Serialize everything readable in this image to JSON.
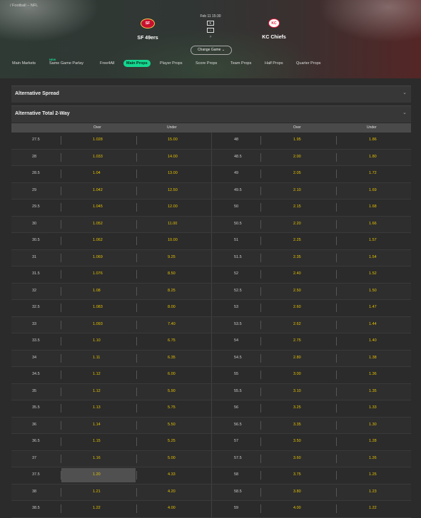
{
  "breadcrumb": "/ Football – NFL",
  "match": {
    "home_team": "SF 49ers",
    "away_team": "KC Chiefs",
    "datetime": "Feb 11 15:30",
    "change_game_label": "Change Game"
  },
  "tabs": [
    {
      "label": "Main Markets"
    },
    {
      "label": "Same Game Parlay",
      "badge": "NEW"
    },
    {
      "label": "Free4All"
    },
    {
      "label": "Main Props",
      "active": true
    },
    {
      "label": "Player Props"
    },
    {
      "label": "Score Props"
    },
    {
      "label": "Team Props"
    },
    {
      "label": "Half Props"
    },
    {
      "label": "Quarter Props"
    }
  ],
  "sections": {
    "spread_title": "Alternative Spread",
    "total_title": "Alternative Total 2-Way"
  },
  "table": {
    "headers": {
      "over": "Over",
      "under": "Under"
    },
    "rows": [
      {
        "l_pt": "27.5",
        "l_over": "1.028",
        "l_under": "15.00",
        "r_pt": "48",
        "r_over": "1.95",
        "r_under": "1.86"
      },
      {
        "l_pt": "28",
        "l_over": "1.033",
        "l_under": "14.00",
        "r_pt": "48.5",
        "r_over": "2.00",
        "r_under": "1.80"
      },
      {
        "l_pt": "28.5",
        "l_over": "1.04",
        "l_under": "13.00",
        "r_pt": "49",
        "r_over": "2.05",
        "r_under": "1.72"
      },
      {
        "l_pt": "29",
        "l_over": "1.042",
        "l_under": "12.50",
        "r_pt": "49.5",
        "r_over": "2.10",
        "r_under": "1.69"
      },
      {
        "l_pt": "29.5",
        "l_over": "1.045",
        "l_under": "12.00",
        "r_pt": "50",
        "r_over": "2.15",
        "r_under": "1.68"
      },
      {
        "l_pt": "30",
        "l_over": "1.052",
        "l_under": "11.00",
        "r_pt": "50.5",
        "r_over": "2.20",
        "r_under": "1.66"
      },
      {
        "l_pt": "30.5",
        "l_over": "1.062",
        "l_under": "10.00",
        "r_pt": "51",
        "r_over": "2.25",
        "r_under": "1.57"
      },
      {
        "l_pt": "31",
        "l_over": "1.069",
        "l_under": "9.25",
        "r_pt": "51.5",
        "r_over": "2.35",
        "r_under": "1.54"
      },
      {
        "l_pt": "31.5",
        "l_over": "1.076",
        "l_under": "8.50",
        "r_pt": "52",
        "r_over": "2.40",
        "r_under": "1.52"
      },
      {
        "l_pt": "32",
        "l_over": "1.08",
        "l_under": "8.25",
        "r_pt": "52.5",
        "r_over": "2.50",
        "r_under": "1.50"
      },
      {
        "l_pt": "32.5",
        "l_over": "1.083",
        "l_under": "8.00",
        "r_pt": "53",
        "r_over": "2.60",
        "r_under": "1.47"
      },
      {
        "l_pt": "33",
        "l_over": "1.093",
        "l_under": "7.40",
        "r_pt": "53.5",
        "r_over": "2.62",
        "r_under": "1.44"
      },
      {
        "l_pt": "33.5",
        "l_over": "1.10",
        "l_under": "6.75",
        "r_pt": "54",
        "r_over": "2.75",
        "r_under": "1.40"
      },
      {
        "l_pt": "34",
        "l_over": "1.11",
        "l_under": "6.35",
        "r_pt": "54.5",
        "r_over": "2.80",
        "r_under": "1.38"
      },
      {
        "l_pt": "34.5",
        "l_over": "1.12",
        "l_under": "6.00",
        "r_pt": "55",
        "r_over": "3.00",
        "r_under": "1.36"
      },
      {
        "l_pt": "35",
        "l_over": "1.12",
        "l_under": "5.90",
        "r_pt": "55.5",
        "r_over": "3.10",
        "r_under": "1.35"
      },
      {
        "l_pt": "35.5",
        "l_over": "1.13",
        "l_under": "5.75",
        "r_pt": "56",
        "r_over": "3.25",
        "r_under": "1.33"
      },
      {
        "l_pt": "36",
        "l_over": "1.14",
        "l_under": "5.50",
        "r_pt": "56.5",
        "r_over": "3.35",
        "r_under": "1.30"
      },
      {
        "l_pt": "36.5",
        "l_over": "1.15",
        "l_under": "5.25",
        "r_pt": "57",
        "r_over": "3.50",
        "r_under": "1.28"
      },
      {
        "l_pt": "37",
        "l_over": "1.16",
        "l_under": "5.00",
        "r_pt": "57.5",
        "r_over": "3.60",
        "r_under": "1.26"
      },
      {
        "l_pt": "37.5",
        "l_over": "1.20",
        "l_under": "4.33",
        "r_pt": "58",
        "r_over": "3.75",
        "r_under": "1.25",
        "highlight": true
      },
      {
        "l_pt": "38",
        "l_over": "1.21",
        "l_under": "4.20",
        "r_pt": "58.5",
        "r_over": "3.80",
        "r_under": "1.23"
      },
      {
        "l_pt": "38.5",
        "l_over": "1.22",
        "l_under": "4.00",
        "r_pt": "59",
        "r_over": "4.00",
        "r_under": "1.22"
      }
    ]
  },
  "colors": {
    "accent": "#14d790",
    "odds": "#e5c100"
  },
  "icons": {
    "chevron": "chevron-down-icon"
  }
}
